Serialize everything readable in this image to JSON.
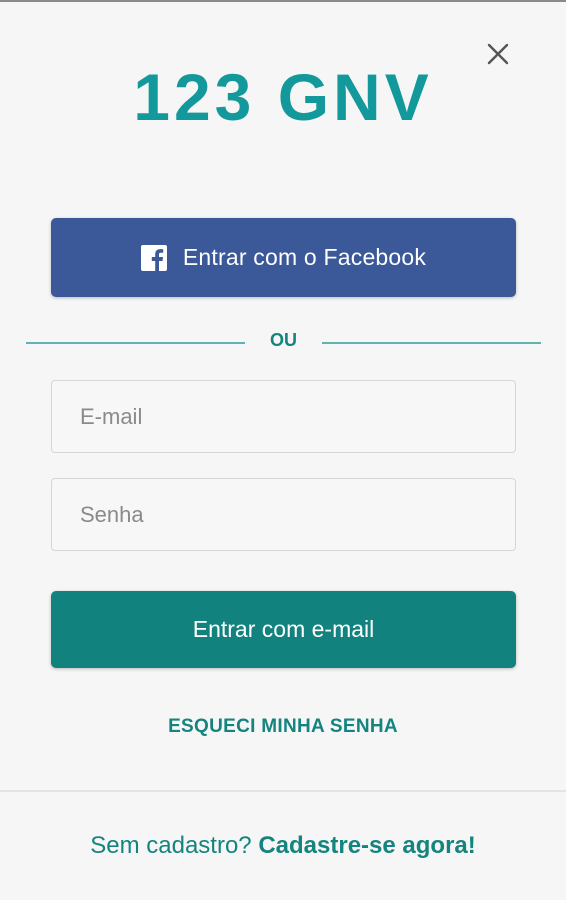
{
  "colors": {
    "brand_teal": "#11827d",
    "facebook_blue": "#3b5898",
    "divider_teal": "#5fb3b0",
    "logo_teal": "#13999b"
  },
  "header": {
    "logo_text": "123 GNV",
    "close_icon": "close-icon"
  },
  "facebook_button": {
    "icon": "facebook-icon",
    "label": "Entrar com o Facebook"
  },
  "divider": {
    "label": "OU"
  },
  "form": {
    "email": {
      "placeholder": "E-mail",
      "value": ""
    },
    "password": {
      "placeholder": "Senha",
      "value": ""
    },
    "submit_label": "Entrar com e-mail"
  },
  "forgot_password": {
    "label": "ESQUECI MINHA SENHA"
  },
  "footer": {
    "prompt": "Sem cadastro?",
    "signup_link": "Cadastre-se agora!"
  }
}
